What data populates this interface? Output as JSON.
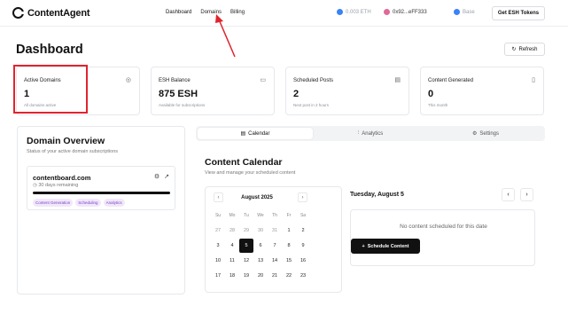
{
  "brand": {
    "name": "ContentAgent"
  },
  "nav": {
    "links": [
      "Dashboard",
      "Domains",
      "Billing"
    ]
  },
  "wallet": {
    "balance": "0.003 ETH",
    "address": "0x92...eFF333",
    "network": "Base",
    "get_tokens_label": "Get ESH Tokens"
  },
  "page": {
    "title": "Dashboard",
    "refresh_label": "Refresh"
  },
  "stats": [
    {
      "label": "Active Domains",
      "value": "1",
      "sub": "All domains active",
      "icon": "globe-icon"
    },
    {
      "label": "ESH Balance",
      "value": "875 ESH",
      "sub": "Available for subscriptions",
      "icon": "wallet-icon"
    },
    {
      "label": "Scheduled Posts",
      "value": "2",
      "sub": "Next post in 2 hours",
      "icon": "calendar-icon"
    },
    {
      "label": "Content Generated",
      "value": "0",
      "sub": "This month",
      "icon": "document-icon"
    }
  ],
  "domain_overview": {
    "title": "Domain Overview",
    "subtitle": "Status of your active domain subscriptions",
    "domain": {
      "name": "contentboard.com",
      "remaining": "30 days remaining",
      "progress": 1.0,
      "tags": [
        "Content Generation",
        "Scheduling",
        "Analytics"
      ]
    }
  },
  "tabs": [
    "Calendar",
    "Analytics",
    "Settings"
  ],
  "calendar": {
    "title": "Content Calendar",
    "subtitle": "View and manage your scheduled content",
    "month": "August 2025",
    "weekdays": [
      "Su",
      "Mo",
      "Tu",
      "We",
      "Th",
      "Fr",
      "Sa"
    ],
    "weeks": [
      [
        "27",
        "28",
        "29",
        "30",
        "31",
        "1",
        "2"
      ],
      [
        "3",
        "4",
        "5",
        "6",
        "7",
        "8",
        "9"
      ],
      [
        "10",
        "11",
        "12",
        "13",
        "14",
        "15",
        "16"
      ],
      [
        "17",
        "18",
        "19",
        "20",
        "21",
        "22",
        "23"
      ]
    ],
    "selected_day": "5"
  },
  "schedule": {
    "date": "Tuesday, August 5",
    "empty_text": "No content scheduled for this date",
    "button_label": "Schedule Content"
  },
  "colors": {
    "accent": "#111111",
    "highlight": "#e0242f",
    "tag_text": "#7b3fc4",
    "tag_bg": "#f1e8fb"
  }
}
